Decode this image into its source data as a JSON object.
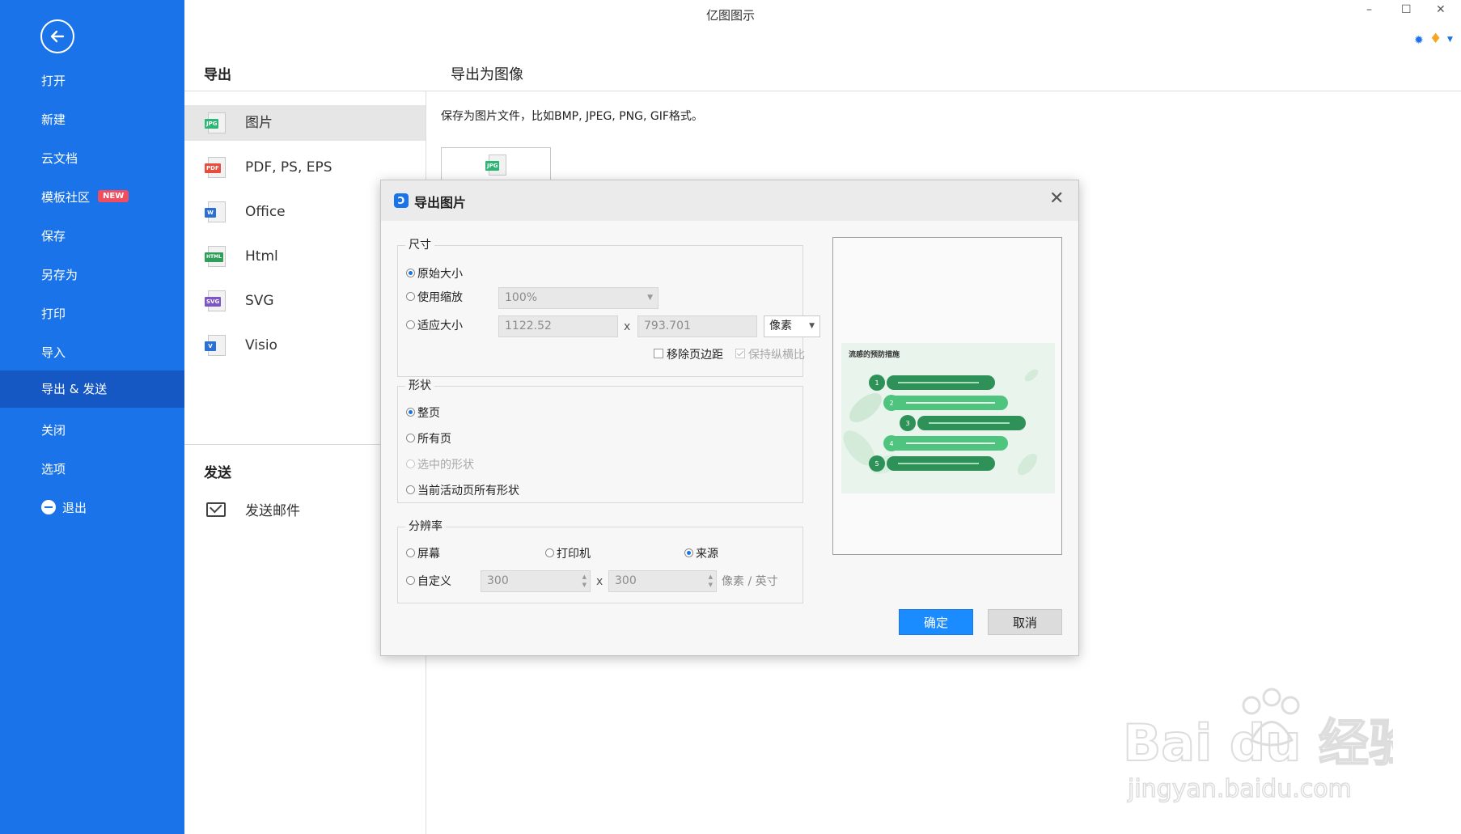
{
  "app_title": "亿图图示",
  "window_controls": {
    "minimize": "–",
    "maximize": "☐",
    "close": "✕"
  },
  "sidebar": {
    "items": [
      {
        "label": "打开"
      },
      {
        "label": "新建"
      },
      {
        "label": "云文档"
      },
      {
        "label": "模板社区",
        "badge": "NEW"
      },
      {
        "label": "保存"
      },
      {
        "label": "另存为"
      },
      {
        "label": "打印"
      },
      {
        "label": "导入"
      },
      {
        "label": "导出 & 发送",
        "active": true
      },
      {
        "label": "关闭"
      },
      {
        "label": "选项"
      },
      {
        "label": "退出"
      }
    ]
  },
  "export_panel": {
    "heading": "导出",
    "formats": [
      {
        "label": "图片",
        "tag": "JPG",
        "color": "#2bb673"
      },
      {
        "label": "PDF, PS, EPS",
        "tag": "PDF",
        "color": "#e84c3d"
      },
      {
        "label": "Office",
        "tag": "W",
        "color": "#2b6fd6"
      },
      {
        "label": "Html",
        "tag": "HTML",
        "color": "#2f9e5b"
      },
      {
        "label": "SVG",
        "tag": "SVG",
        "color": "#7d55c7"
      },
      {
        "label": "Visio",
        "tag": "V",
        "color": "#2b6fd6"
      }
    ],
    "send_heading": "发送",
    "send_email": "发送邮件"
  },
  "right_panel": {
    "heading": "导出为图像",
    "description": "保存为图片文件，比如BMP, JPEG, PNG, GIF格式。",
    "tile_tag": "JPG"
  },
  "dialog": {
    "title": "导出图片",
    "size": {
      "legend": "尺寸",
      "original": "原始大小",
      "use_scale": "使用缩放",
      "scale_value": "100%",
      "fit_size": "适应大小",
      "width": "1122.52",
      "times": "x",
      "height": "793.701",
      "unit": "像素",
      "remove_margin": "移除页边距",
      "keep_ratio": "保持纵横比"
    },
    "shape": {
      "legend": "形状",
      "whole_page": "整页",
      "all_pages": "所有页",
      "selected_shapes": "选中的形状",
      "active_page_shapes": "当前活动页所有形状"
    },
    "resolution": {
      "legend": "分辨率",
      "screen": "屏幕",
      "printer": "打印机",
      "source": "来源",
      "custom": "自定义",
      "dpi_x": "300",
      "times": "x",
      "dpi_y": "300",
      "unit": "像素 / 英寸"
    },
    "preview": {
      "title": "流感的预防措施",
      "steps": [
        "1",
        "2",
        "3",
        "4",
        "5"
      ]
    },
    "ok": "确定",
    "cancel": "取消"
  },
  "watermark": {
    "brand": "Bai du 经验",
    "url": "jingyan.baidu.com"
  }
}
